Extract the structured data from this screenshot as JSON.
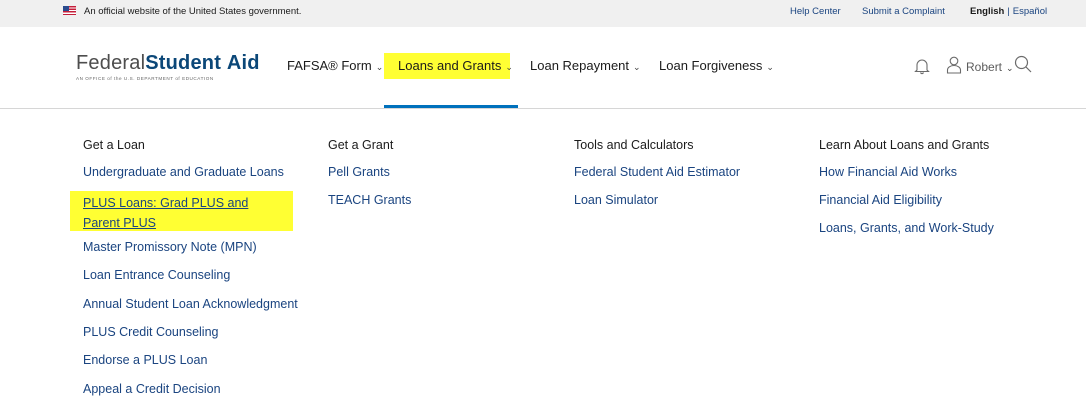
{
  "gov_banner": {
    "text": "An official website of the United States government.",
    "help_center": "Help Center",
    "submit_complaint": "Submit a Complaint",
    "lang_english": "English",
    "lang_separator": "|",
    "lang_espanol": "Español"
  },
  "logo": {
    "part1": "Federal",
    "part2": "Student",
    "part3": "Aid",
    "tagline": "AN OFFICE of the U.S. DEPARTMENT of EDUCATION"
  },
  "nav": {
    "fafsa": "FAFSA® Form",
    "loans_grants": "Loans and Grants",
    "repayment": "Loan Repayment",
    "forgiveness": "Loan Forgiveness"
  },
  "user": {
    "name": "Robert"
  },
  "icons": {
    "bell": "bell-icon",
    "user": "user-icon",
    "search": "search-icon",
    "chevron": "chevron-down-icon",
    "flag": "us-flag-icon"
  },
  "colors": {
    "link": "#1a4480",
    "highlight": "#ffff33",
    "active_underline": "#0071bc",
    "brand": "#0b4778"
  },
  "menu": {
    "get_loan": {
      "title": "Get a Loan",
      "links": [
        "Undergraduate and Graduate Loans",
        "PLUS Loans: Grad PLUS and Parent PLUS",
        "Master Promissory Note (MPN)",
        "Loan Entrance Counseling",
        "Annual Student Loan Acknowledgment",
        "PLUS Credit Counseling",
        "Endorse a PLUS Loan",
        "Appeal a Credit Decision"
      ]
    },
    "get_grant": {
      "title": "Get a Grant",
      "links": [
        "Pell Grants",
        "TEACH Grants"
      ]
    },
    "tools": {
      "title": "Tools and Calculators",
      "links": [
        "Federal Student Aid Estimator",
        "Loan Simulator"
      ]
    },
    "learn": {
      "title": "Learn About Loans and Grants",
      "links": [
        "How Financial Aid Works",
        "Financial Aid Eligibility",
        "Loans, Grants, and Work-Study"
      ]
    }
  }
}
